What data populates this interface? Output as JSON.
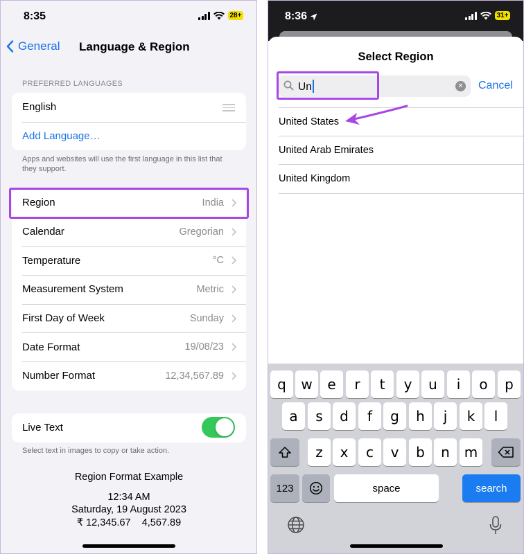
{
  "left": {
    "status": {
      "time": "8:35",
      "battery": "28+"
    },
    "nav": {
      "back_label": "General",
      "title": "Language & Region"
    },
    "preferred_languages": {
      "header": "PREFERRED LANGUAGES",
      "languages": [
        "English"
      ],
      "add_label": "Add Language…",
      "footnote": "Apps and websites will use the first language in this list that they support."
    },
    "settings": [
      {
        "label": "Region",
        "value": "India"
      },
      {
        "label": "Calendar",
        "value": "Gregorian"
      },
      {
        "label": "Temperature",
        "value": "°C"
      },
      {
        "label": "Measurement System",
        "value": "Metric"
      },
      {
        "label": "First Day of Week",
        "value": "Sunday"
      },
      {
        "label": "Date Format",
        "value": "19/08/23"
      },
      {
        "label": "Number Format",
        "value": "12,34,567.89"
      }
    ],
    "live_text": {
      "label": "Live Text",
      "enabled": true,
      "footnote": "Select text in images to copy or take action."
    },
    "example": {
      "title": "Region Format Example",
      "time": "12:34 AM",
      "date": "Saturday, 19 August 2023",
      "currency": "₹ 12,345.67",
      "number": "4,567.89"
    }
  },
  "right": {
    "status": {
      "time": "8:36",
      "battery": "31+"
    },
    "sheet_title": "Select Region",
    "search": {
      "value": "Un"
    },
    "cancel_label": "Cancel",
    "results": [
      "United States",
      "United Arab Emirates",
      "United Kingdom"
    ],
    "keyboard": {
      "row1": [
        "q",
        "w",
        "e",
        "r",
        "t",
        "y",
        "u",
        "i",
        "o",
        "p"
      ],
      "row2": [
        "a",
        "s",
        "d",
        "f",
        "g",
        "h",
        "j",
        "k",
        "l"
      ],
      "row3": [
        "z",
        "x",
        "c",
        "v",
        "b",
        "n",
        "m"
      ],
      "numbers_label": "123",
      "space_label": "space",
      "search_label": "search"
    }
  },
  "colors": {
    "accent": "#1a73e8",
    "highlight": "#a647e6",
    "toggle_on": "#34c759"
  }
}
